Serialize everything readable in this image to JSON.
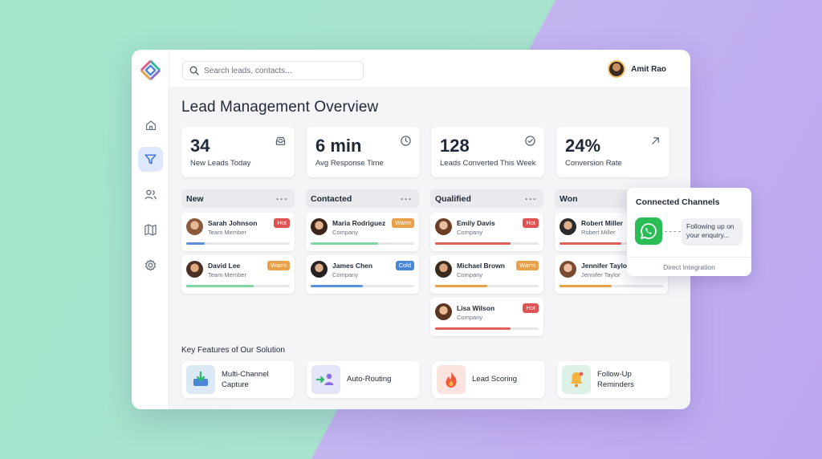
{
  "user": {
    "name": "Amit Rao"
  },
  "search": {
    "placeholder": "Search leads, contacts..."
  },
  "page": {
    "title": "Lead Management Overview"
  },
  "sidebar": {
    "items": [
      {
        "icon": "home-icon"
      },
      {
        "icon": "filter-icon",
        "active": true
      },
      {
        "icon": "users-icon"
      },
      {
        "icon": "map-icon"
      },
      {
        "icon": "settings-icon"
      }
    ]
  },
  "stats": [
    {
      "value": "34",
      "label": "New Leads Today",
      "icon": "inbox-icon"
    },
    {
      "value": "6 min",
      "label": "Avg Response Time",
      "icon": "clock-icon"
    },
    {
      "value": "128",
      "label": "Leads Converted This Week",
      "icon": "check-circle-icon"
    },
    {
      "value": "24%",
      "label": "Conversion Rate",
      "icon": "arrow-up-right-icon"
    }
  ],
  "columns": [
    {
      "title": "New",
      "more": "···"
    },
    {
      "title": "Contacted",
      "more": "···"
    },
    {
      "title": "Qualified",
      "more": "···"
    },
    {
      "title": "Won"
    }
  ],
  "leads": {
    "new": [
      {
        "name": "Sarah Johnson",
        "role": "Team Member",
        "tag": "Hot",
        "progress": 0.18
      },
      {
        "name": "David Lee",
        "role": "Team Member",
        "tag": "Warm",
        "progress": 0.65
      }
    ],
    "contacted": [
      {
        "name": "Maria Rodriguez",
        "role": "Company",
        "tag": "Warm",
        "progress": 0.65
      },
      {
        "name": "James Chen",
        "role": "Company",
        "tag": "Cold",
        "progress": 0.5
      }
    ],
    "qualified": [
      {
        "name": "Emily Davis",
        "role": "Company",
        "tag": "Hot",
        "progress": 0.73
      },
      {
        "name": "Michael Brown",
        "role": "Company",
        "tag": "Warm",
        "progress": 0.5
      },
      {
        "name": "Lisa Wilson",
        "role": "Company",
        "tag": "Hot",
        "progress": 0.73
      }
    ],
    "won": [
      {
        "name": "Robert Miller",
        "role": "Robert Miller",
        "progress": 0.6
      },
      {
        "name": "Jennifer Taylo",
        "role": "Jennifer Taylor",
        "progress": 0.5
      }
    ]
  },
  "colors": {
    "hot": "#e05252",
    "warm": "#e8a04a",
    "cold": "#4a86d6",
    "blue_bar": "#5b8fe0",
    "green_bar": "#7fd6a0",
    "red_bar": "#e0605c",
    "orange_bar": "#e8a04a"
  },
  "features": {
    "title": "Key Features of Our Solution",
    "items": [
      {
        "label_1": "Multi-Channel",
        "label_2": "Capture",
        "icon": "download-tray-icon"
      },
      {
        "label": "Auto-Routing",
        "icon": "routing-users-icon"
      },
      {
        "label": "Lead Scoring",
        "icon": "flame-icon"
      },
      {
        "label_1": "Follow-Up",
        "label_2": "Reminders",
        "icon": "bell-icon"
      }
    ]
  },
  "channels": {
    "title": "Connected Channels",
    "message": "Following up on your enquiry...",
    "footer": "Direct Integration",
    "icon": "whatsapp-icon"
  }
}
